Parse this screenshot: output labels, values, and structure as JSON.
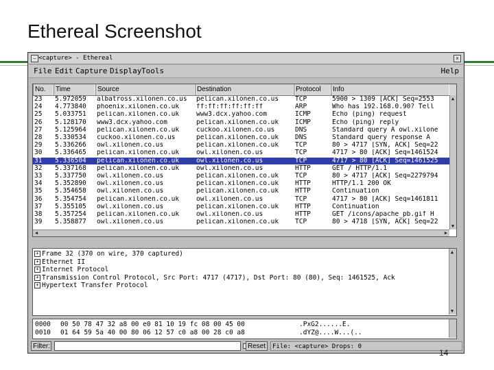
{
  "slide": {
    "title": "Ethereal Screenshot",
    "page_number": "14"
  },
  "window": {
    "title": "<capture> - Ethereal",
    "close_glyph": "x"
  },
  "menu": {
    "file": "File",
    "edit": "Edit",
    "capture": "Capture",
    "display": "Display",
    "tools": "Tools",
    "help": "Help"
  },
  "packet_list": {
    "columns": [
      "No.",
      "Time",
      "Source",
      "Destination",
      "Protocol",
      "Info"
    ],
    "selected_index": 8,
    "rows": [
      [
        "23",
        "5.972059",
        "albatross.xilonen.co.us",
        "pelican.xilonen.co.us",
        "TCP",
        "5900 > 1309 [ACK] Seq=2553"
      ],
      [
        "24",
        "4.773840",
        "phoenix.xilonen.co.uk",
        "ff:ff:ff:ff:ff:ff",
        "ARP",
        "Who has 192.168.0.90? Tell"
      ],
      [
        "25",
        "5.033751",
        "pelican.xilonen.co.uk",
        "www3.dcx.yahoo.com",
        "ICMP",
        "Echo (ping) request"
      ],
      [
        "26",
        "5.128170",
        "www3.dcx.yahoo.com",
        "pelican.xilonen.co.uk",
        "ICMP",
        "Echo (ping) reply"
      ],
      [
        "27",
        "5.125964",
        "pelican.xilonen.co.uk",
        "cuckoo.xilonen.co.us",
        "DNS",
        "Standard query A owl.xilone"
      ],
      [
        "28",
        "5.330534",
        "cuckoo.xilonen.co.us",
        "pelican.xilonen.co.uk",
        "DNS",
        "Standard query response A"
      ],
      [
        "29",
        "5.336266",
        "owl.xilonen.co.us",
        "pelican.xilonen.co.uk",
        "TCP",
        "80 > 4717 [SYN, ACK] Seq=22"
      ],
      [
        "30",
        "5.336465",
        "pelican.xilonen.co.uk",
        "owl.xilonen.co.us",
        "TCP",
        "4717 > 80 [ACK] Seq=1461524"
      ],
      [
        "31",
        "5.336504",
        "pelican.xilonen.co.uk",
        "owl.xilonen.co.us",
        "TCP",
        "4717 > 80 [ACK] Seq=1461525"
      ],
      [
        "32",
        "5.337168",
        "pelican.xilonen.co.uk",
        "owl.xilonen.co.us",
        "HTTP",
        "GET / HTTP/1.1"
      ],
      [
        "33",
        "5.337750",
        "owl.xilonen.co.us",
        "pelican.xilonen.co.uk",
        "TCP",
        "80 > 4717 [ACK] Seq=2279794"
      ],
      [
        "34",
        "5.352890",
        "owl.xilonen.co.us",
        "pelican.xilonen.co.uk",
        "HTTP",
        "HTTP/1.1 200 OK"
      ],
      [
        "35",
        "5.354658",
        "owl.xilonen.co.us",
        "pelican.xilonen.co.uk",
        "HTTP",
        "Continuation"
      ],
      [
        "36",
        "5.354754",
        "pelican.xilonen.co.uk",
        "owl.xilonen.co.us",
        "TCP",
        "4717 > 80 [ACK] Seq=1461811"
      ],
      [
        "37",
        "5.355105",
        "owl.xilonen.co.us",
        "pelican.xilonen.co.uk",
        "HTTP",
        "Continuation"
      ],
      [
        "38",
        "5.357254",
        "pelican.xilonen.co.uk",
        "owl.xilonen.co.us",
        "HTTP",
        "GET /icons/apache_pb.gif H"
      ],
      [
        "39",
        "5.358877",
        "owl.xilonen.co.us",
        "pelican.xilonen.co.uk",
        "TCP",
        "80 > 4718 [SYN, ACK] Seq=22"
      ]
    ]
  },
  "details": [
    "Frame 32 (370 on wire, 370 captured)",
    "Ethernet II",
    "Internet Protocol",
    "Transmission Control Protocol, Src Port: 4717 (4717), Dst Port: 80 (80), Seq: 1461525, Ack",
    "Hypertext Transfer Protocol"
  ],
  "hex": [
    {
      "offset": "0000",
      "bytes": "00 50 78 47 32 a8 00 e0  81 10 19 fc 08 00 45 00",
      "ascii": ".PxG2......E."
    },
    {
      "offset": "0010",
      "bytes": "01 64 59 5a 40 00 80 06  12 57 c0 a8 00 28 c0 a8",
      "ascii": ".dYZ@....W...(.."
    }
  ],
  "status": {
    "filter_label": "Filter:",
    "filter_value": "",
    "reset_label": "Reset",
    "text": "File: <capture>  Drops: 0"
  }
}
